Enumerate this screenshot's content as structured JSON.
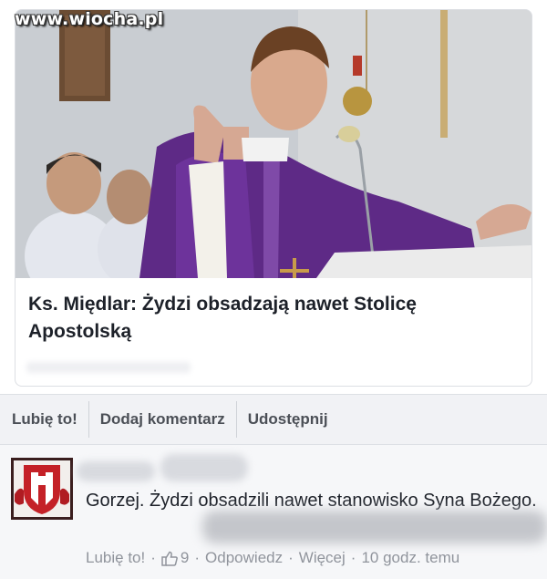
{
  "watermark": "www.wiocha.pl",
  "link_preview": {
    "image": "priest-in-purple-vestments-photo",
    "headline": "Ks. Międlar: Żydzi obsadzają nawet Stolicę Apostolską"
  },
  "actions": {
    "like": "Lubię to!",
    "comment": "Dodaj komentarz",
    "share": "Udostępnij"
  },
  "comment": {
    "avatar": "red-white-coat-of-arms",
    "text": "Gorzej. Żydzi obsadzili nawet stanowisko Syna Bożego.",
    "meta": {
      "like": "Lubię to!",
      "like_icon": "thumbs-up-icon",
      "like_count": "9",
      "reply": "Odpowiedz",
      "more": "Więcej",
      "time": "10 godz. temu"
    }
  },
  "colors": {
    "text": "#1d2129",
    "meta": "#90949c",
    "action": "#4b4f56",
    "vestment": "#5e2a86"
  }
}
